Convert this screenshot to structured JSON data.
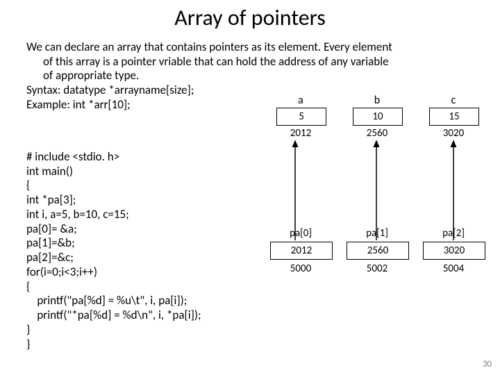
{
  "title": "Array of pointers",
  "para": {
    "l1": "We can declare an array that contains pointers as its element. Every element",
    "l2": "of this array is a pointer vriable  that can hold the address of any variable",
    "l3": "of appropriate type.",
    "l4": "Syntax:  datatype *arrayname[size];",
    "l5": "Example:    int *arr[10];"
  },
  "code": "# include <stdio. h>\nint main()\n{\nint *pa[3];\nint i, a=5, b=10, c=15;\npa[0]= &a;\npa[1]=&b;\npa[2]=&c;\nfor(i=0;i<3;i++)\n{\n    printf(\"pa[%d] = %u\\t\", i, pa[i]);\n    printf(\"*pa[%d] = %d\\n\", i, *pa[i]);\n}\n}",
  "diagram": {
    "vars": [
      {
        "label": "a",
        "value": "5",
        "addr": "2012"
      },
      {
        "label": "b",
        "value": "10",
        "addr": "2560"
      },
      {
        "label": "c",
        "value": "15",
        "addr": "3020"
      }
    ],
    "pa": [
      {
        "label": "pa[0]",
        "value": "2012",
        "addr": "5000"
      },
      {
        "label": "pa[1]",
        "value": "2560",
        "addr": "5002"
      },
      {
        "label": "pa[2]",
        "value": "3020",
        "addr": "5004"
      }
    ]
  },
  "page": "30"
}
